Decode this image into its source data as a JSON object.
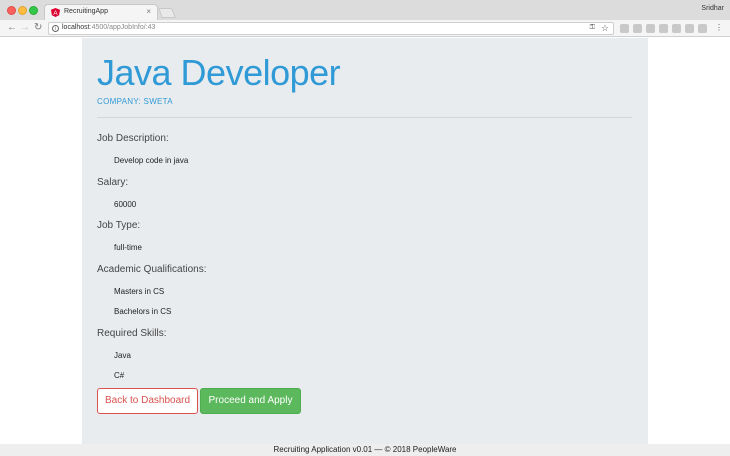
{
  "browser": {
    "tab_title": "RecruitingApp",
    "tab_close": "×",
    "user": "Sridhar",
    "url_host": "localhost",
    "url_path": ":4500/appJobInfo/:43",
    "icons": [
      "back-arrow-icon",
      "forward-arrow-icon",
      "reload-icon",
      "info-icon",
      "key-icon",
      "star-icon",
      "menu-icon"
    ]
  },
  "job": {
    "title": "Java Developer",
    "company": "COMPANY: SWETA",
    "sections": [
      {
        "label": "Job Description:",
        "values": [
          "Develop code in java"
        ]
      },
      {
        "label": "Salary:",
        "values": [
          "60000"
        ]
      },
      {
        "label": "Job Type:",
        "values": [
          "full-time"
        ]
      },
      {
        "label": "Academic Qualifications:",
        "values": [
          "Masters in CS",
          "Bachelors in CS"
        ]
      },
      {
        "label": "Required Skills:",
        "values": [
          "Java",
          "C#"
        ]
      }
    ]
  },
  "actions": {
    "back_label": "Back to Dashboard",
    "apply_label": "Proceed and Apply"
  },
  "footer": {
    "text": "Recruiting Application v0.01 — © 2018 PeopleWare"
  },
  "colors": {
    "accent": "#2f9ad6",
    "danger": "#d9534f",
    "success": "#5cb85c",
    "panel": "#e9ecef"
  }
}
